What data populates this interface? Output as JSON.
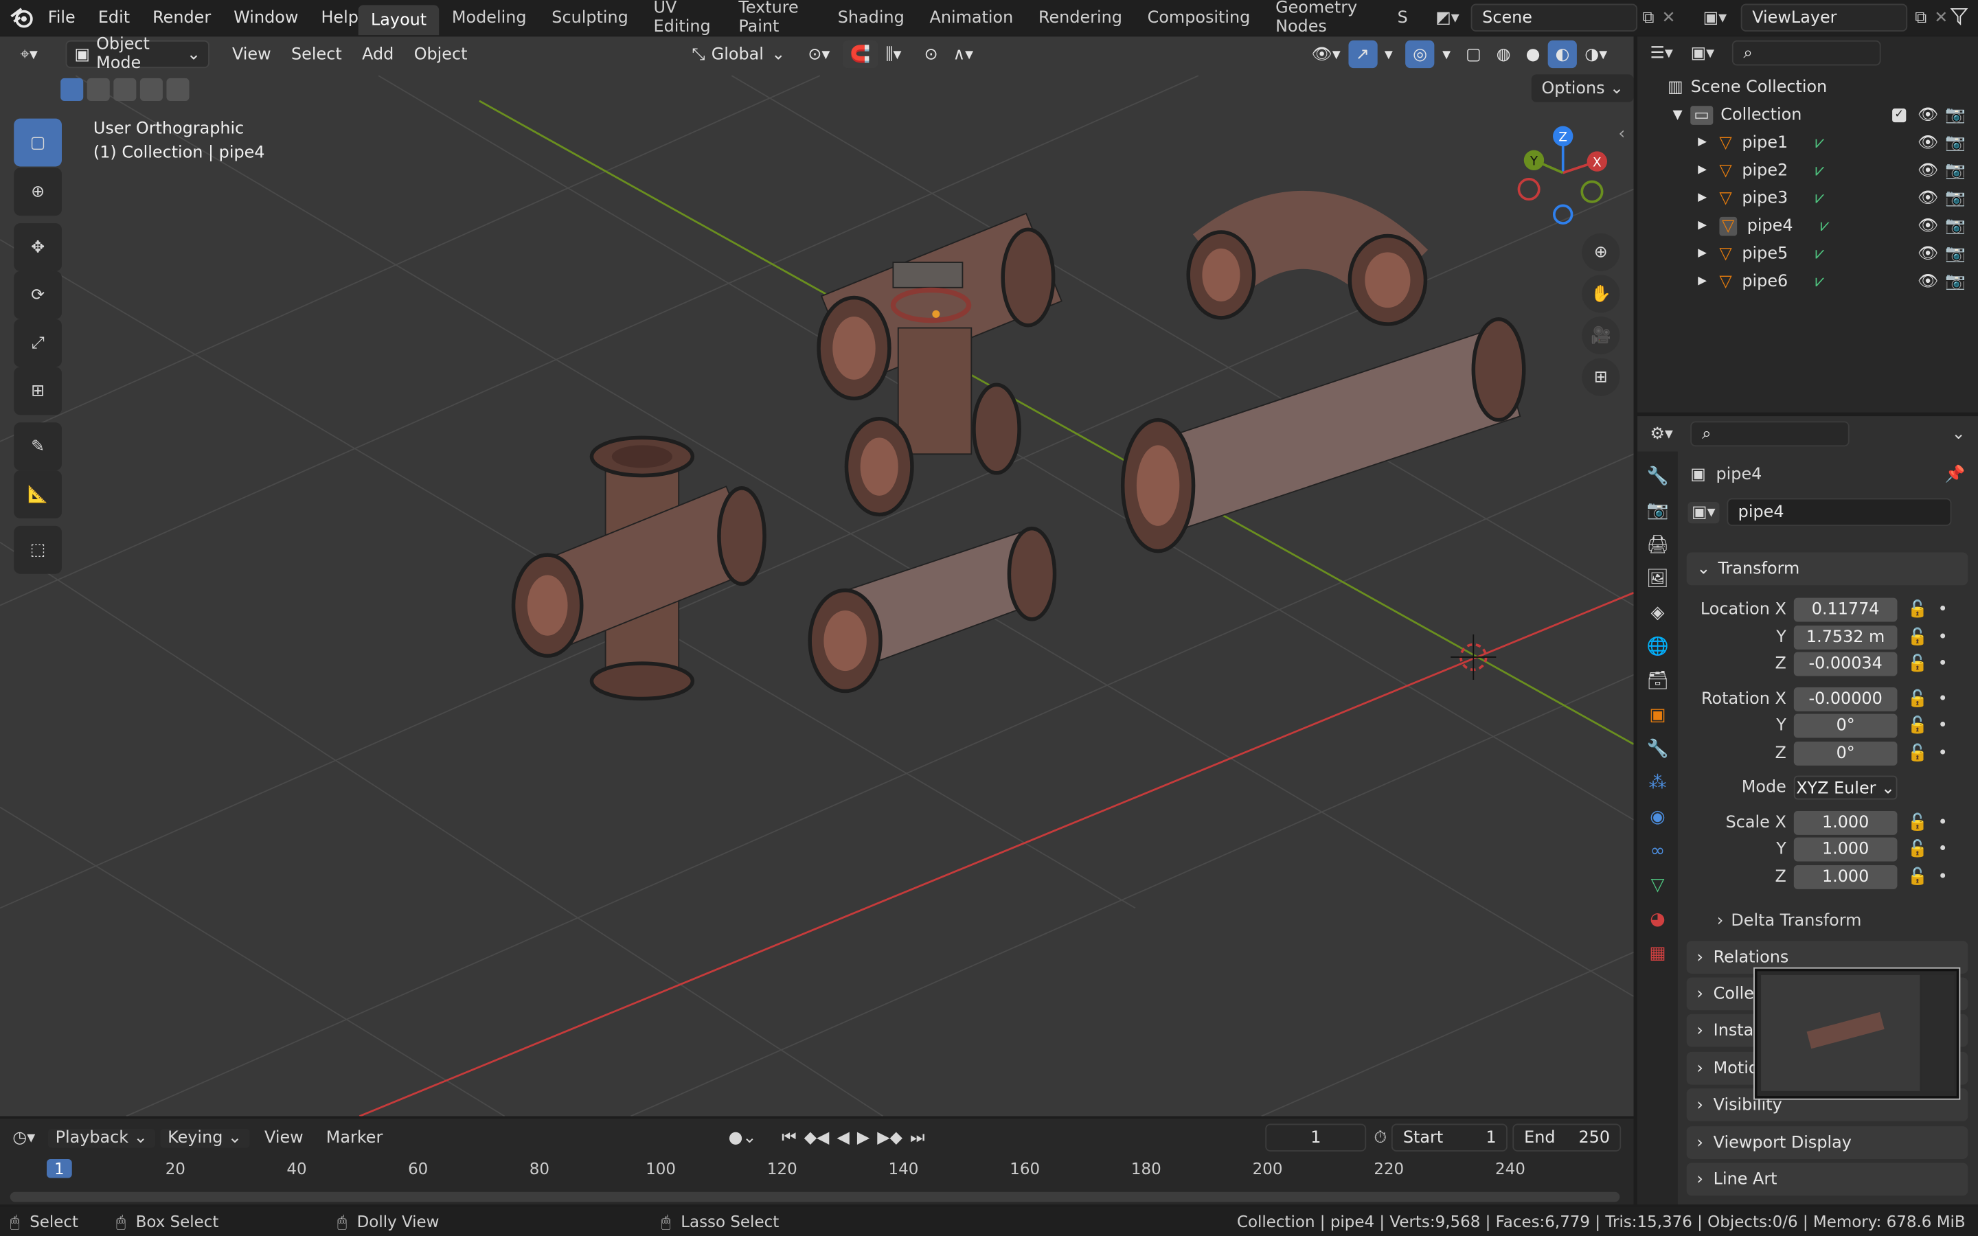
{
  "menu": [
    "File",
    "Edit",
    "Render",
    "Window",
    "Help"
  ],
  "workspaces": [
    "Layout",
    "Modeling",
    "Sculpting",
    "UV Editing",
    "Texture Paint",
    "Shading",
    "Animation",
    "Rendering",
    "Compositing",
    "Geometry Nodes",
    "S"
  ],
  "scene": "Scene",
  "view_layer": "ViewLayer",
  "viewport": {
    "mode": "Object Mode",
    "menus": [
      "View",
      "Select",
      "Add",
      "Object"
    ],
    "orientation": "Global",
    "options": "Options",
    "view_name": "User Orthographic",
    "context": "(1) Collection | pipe4"
  },
  "gizmo": {
    "x": "X",
    "y": "Y",
    "z": "Z"
  },
  "outliner": {
    "scene_collection": "Scene Collection",
    "collection": "Collection",
    "items": [
      "pipe1",
      "pipe2",
      "pipe3",
      "pipe4",
      "pipe5",
      "pipe6"
    ]
  },
  "props": {
    "object": "pipe4",
    "name": "pipe4",
    "transform": "Transform",
    "loc_label": "Location X",
    "loc": [
      "0.11774",
      "1.7532 m",
      "-0.00034"
    ],
    "rot_label": "Rotation X",
    "rot": [
      "-0.00000",
      "0°",
      "0°"
    ],
    "mode_label": "Mode",
    "mode": "XYZ Euler",
    "scale_label": "Scale X",
    "scale": [
      "1.000",
      "1.000",
      "1.000"
    ],
    "y": "Y",
    "z": "Z",
    "delta": "Delta Transform",
    "panels": [
      "Relations",
      "Colle",
      "Insta",
      "Motio",
      "Visibility",
      "Viewport Display",
      "Line Art"
    ]
  },
  "timeline": {
    "menus": [
      "Playback",
      "Keying",
      "View",
      "Marker"
    ],
    "frame": "1",
    "start_label": "Start",
    "start": "1",
    "end_label": "End",
    "end": "250",
    "ticks": [
      "1",
      "20",
      "40",
      "60",
      "80",
      "100",
      "120",
      "140",
      "160",
      "180",
      "200",
      "220",
      "240"
    ]
  },
  "status": {
    "select": "Select",
    "box": "Box Select",
    "dolly": "Dolly View",
    "lasso": "Lasso Select",
    "info": "Collection | pipe4 | Verts:9,568 | Faces:6,779 | Tris:15,376 | Objects:0/6 | Memory: 678.6 MiB"
  },
  "colors": {
    "accent": "#4772b3",
    "x_axis": "#c63b3b",
    "y_axis": "#6a8f1f",
    "z_axis": "#2f80ed",
    "active_tab": "#e87d0d"
  }
}
